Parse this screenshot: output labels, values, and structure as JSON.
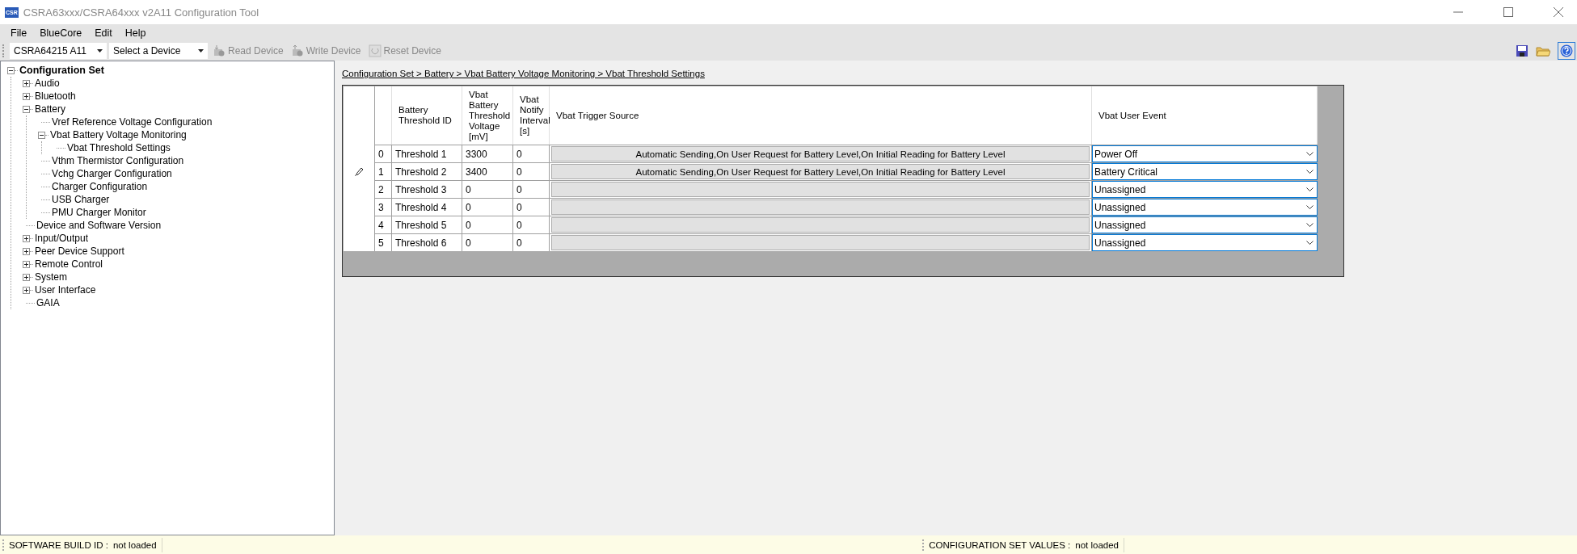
{
  "window": {
    "title": "CSRA63xxx/CSRA64xxx v2A11 Configuration Tool",
    "logo": "CSR"
  },
  "menu": [
    "File",
    "BlueCore",
    "Edit",
    "Help"
  ],
  "toolbar": {
    "chip_select": "CSRA64215 A11",
    "device_select": "Select a Device",
    "buttons": [
      {
        "label": "Read Device",
        "kind": "read",
        "disabled": true
      },
      {
        "label": "Write Device",
        "kind": "write",
        "disabled": true
      },
      {
        "label": "Reset Device",
        "kind": "reset",
        "disabled": true
      }
    ]
  },
  "tree": [
    {
      "label": "Configuration Set",
      "expanded": true,
      "children": [
        {
          "label": "Audio",
          "expanded": false
        },
        {
          "label": "Bluetooth",
          "expanded": false
        },
        {
          "label": "Battery",
          "expanded": true,
          "children": [
            {
              "label": "Vref Reference Voltage Configuration"
            },
            {
              "label": "Vbat Battery Voltage Monitoring",
              "expanded": true,
              "children": [
                {
                  "label": "Vbat Threshold Settings"
                }
              ]
            },
            {
              "label": "Vthm Thermistor Configuration"
            },
            {
              "label": "Vchg Charger Configuration"
            },
            {
              "label": "Charger Configuration"
            },
            {
              "label": "USB Charger"
            },
            {
              "label": "PMU Charger Monitor"
            }
          ]
        },
        {
          "label": "Device and Software Version"
        },
        {
          "label": "Input/Output",
          "expanded": false
        },
        {
          "label": "Peer Device Support",
          "expanded": false
        },
        {
          "label": "Remote Control",
          "expanded": false
        },
        {
          "label": "System",
          "expanded": false
        },
        {
          "label": "User Interface",
          "expanded": false
        },
        {
          "label": "GAIA"
        }
      ]
    }
  ],
  "breadcrumb": "Configuration Set > Battery > Vbat Battery Voltage Monitoring > Vbat Threshold Settings",
  "table": {
    "columns": [
      "Battery Threshold ID",
      "Vbat Battery Threshold Voltage [mV]",
      "Vbat Notify Interval [s]",
      "Vbat Trigger Source",
      "Vbat User Event"
    ],
    "rows": [
      {
        "index": "0",
        "editing": false,
        "id": "Threshold 1",
        "voltage": "3300",
        "interval": "0",
        "trigger": "Automatic Sending,On User Request for Battery Level,On Initial Reading for Battery Level",
        "event": "Power Off"
      },
      {
        "index": "1",
        "editing": true,
        "id": "Threshold 2",
        "voltage": "3400",
        "interval": "0",
        "trigger": "Automatic Sending,On User Request for Battery Level,On Initial Reading for Battery Level",
        "event": "Battery Critical"
      },
      {
        "index": "2",
        "editing": false,
        "id": "Threshold 3",
        "voltage": "0",
        "interval": "0",
        "event": "Unassigned"
      },
      {
        "index": "3",
        "editing": false,
        "id": "Threshold 4",
        "voltage": "0",
        "interval": "0",
        "event": "Unassigned"
      },
      {
        "index": "4",
        "editing": false,
        "id": "Threshold 5",
        "voltage": "0",
        "interval": "0",
        "event": "Unassigned"
      },
      {
        "index": "5",
        "editing": false,
        "id": "Threshold 6",
        "voltage": "0",
        "interval": "0",
        "event": "Unassigned"
      }
    ]
  },
  "status_bar": [
    {
      "label": "SOFTWARE BUILD ID :",
      "value": "not loaded"
    },
    {
      "label": "CONFIGURATION SET VALUES :",
      "value": "not loaded"
    }
  ]
}
